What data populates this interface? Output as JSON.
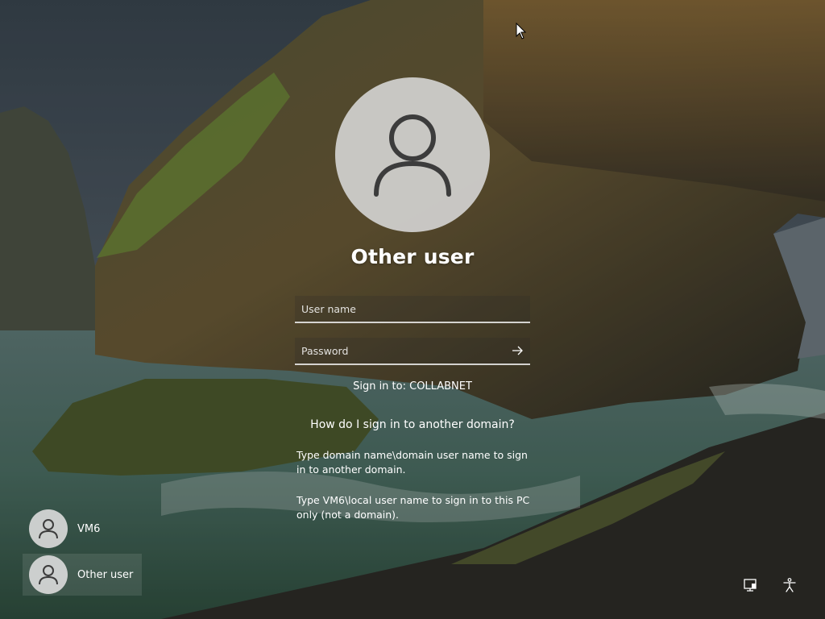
{
  "background": {
    "sky_color": "#3e4b55",
    "rock_color": "#4a4632",
    "moss_color": "#6f8a3a",
    "sea_color": "#3f6a5a"
  },
  "login": {
    "avatar_icon": "user-silhouette-icon",
    "title": "Other user",
    "username_placeholder": "User name",
    "password_placeholder": "Password",
    "submit_icon": "arrow-right-icon",
    "sign_in_to": "Sign in to: COLLABNET",
    "help_link": "How do I sign in to another domain?",
    "help_line_1": "Type domain name\\domain user name to sign in to another domain.",
    "help_line_2": "Type VM6\\local user name to sign in to this PC only (not a domain)."
  },
  "users": [
    {
      "name": "VM6",
      "selected": false,
      "icon": "user-silhouette-icon"
    },
    {
      "name": "Other user",
      "selected": true,
      "icon": "user-silhouette-icon"
    }
  ],
  "system_tray": {
    "network_icon": "network-icon",
    "accessibility_icon": "accessibility-icon"
  }
}
